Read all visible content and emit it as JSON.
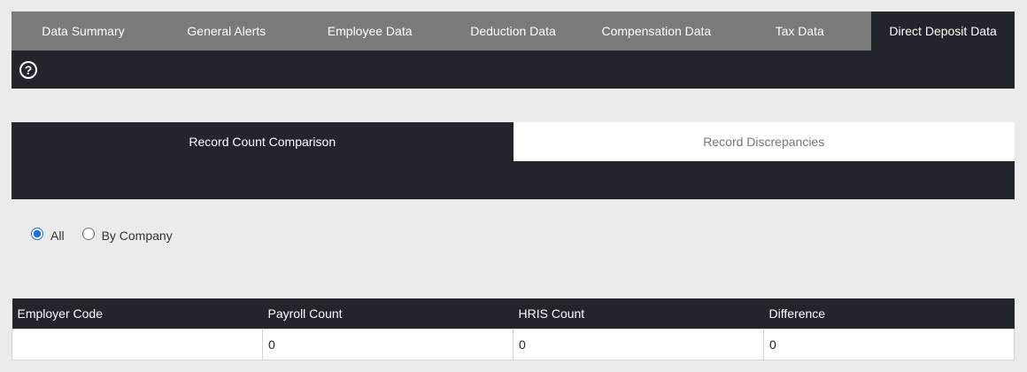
{
  "top_tabs": [
    {
      "label": "Data Summary"
    },
    {
      "label": "General Alerts"
    },
    {
      "label": "Employee Data"
    },
    {
      "label": "Deduction Data"
    },
    {
      "label": "Compensation Data"
    },
    {
      "label": "Tax Data"
    },
    {
      "label": "Direct Deposit Data"
    }
  ],
  "active_top_tab": "Direct Deposit Data",
  "help": {
    "icon": "help-icon",
    "glyph": "?"
  },
  "sub_tabs": [
    {
      "label": "Record Count Comparison"
    },
    {
      "label": "Record Discrepancies"
    }
  ],
  "active_sub_tab": "Record Count Comparison",
  "filter": {
    "options": [
      {
        "label": "All",
        "checked": true
      },
      {
        "label": "By Company",
        "checked": false
      }
    ]
  },
  "table": {
    "headers": [
      "Employer Code",
      "Payroll Count",
      "HRIS Count",
      "Difference"
    ],
    "rows": [
      [
        "",
        "0",
        "0",
        "0"
      ]
    ]
  },
  "colors": {
    "dark": "#22252b",
    "tab_gray": "#7a7a7a",
    "background": "#ebebeb"
  }
}
